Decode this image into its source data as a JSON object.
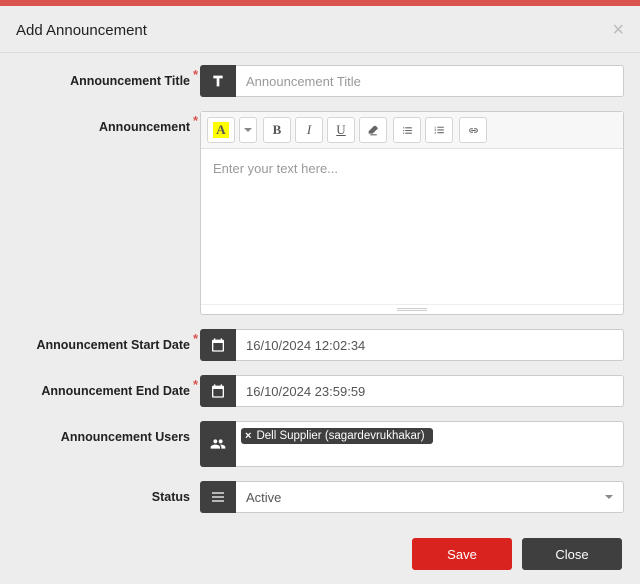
{
  "modal": {
    "title": "Add Announcement"
  },
  "fields": {
    "title": {
      "label": "Announcement Title",
      "placeholder": "Announcement Title",
      "value": ""
    },
    "body": {
      "label": "Announcement",
      "placeholder": "Enter your text here..."
    },
    "start": {
      "label": "Announcement Start Date",
      "value": "16/10/2024 12:02:34"
    },
    "end": {
      "label": "Announcement End Date",
      "value": "16/10/2024 23:59:59"
    },
    "users": {
      "label": "Announcement Users",
      "tags": [
        "Dell Supplier (sagardevrukhakar)"
      ]
    },
    "status": {
      "label": "Status",
      "value": "Active"
    }
  },
  "buttons": {
    "save": "Save",
    "close": "Close"
  }
}
